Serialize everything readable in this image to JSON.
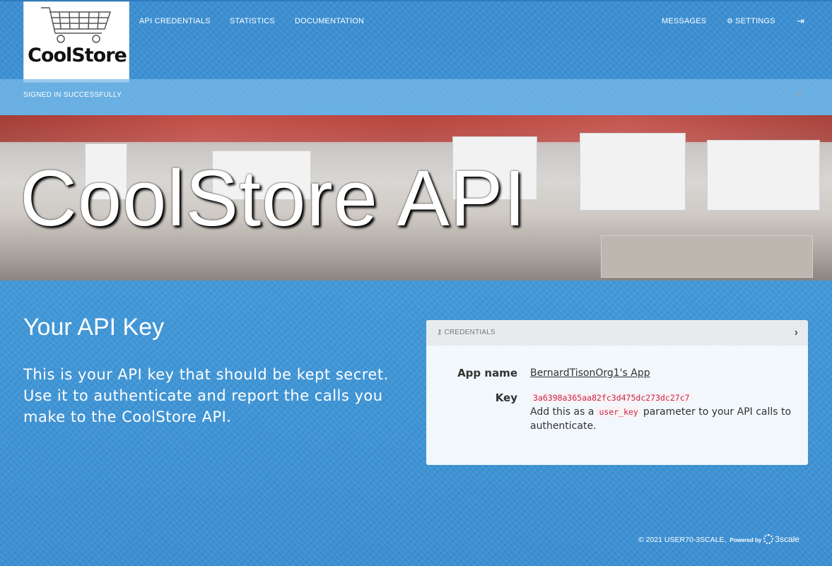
{
  "nav": {
    "logo_text": "CoolStore",
    "links": [
      {
        "label": "API CREDENTIALS"
      },
      {
        "label": "STATISTICS"
      },
      {
        "label": "DOCUMENTATION"
      }
    ],
    "messages": "MESSAGES",
    "settings": "SETTINGS",
    "settings_icon": "gears-icon",
    "logout_icon": "sign-out-icon"
  },
  "flash": {
    "message": "SIGNED IN SUCCESSFULLY",
    "close": "×"
  },
  "hero": {
    "title": "CoolStore API"
  },
  "main": {
    "heading": "Your API Key",
    "description": "This is your API key that should be kept secret. Use it to authenticate and report the calls you make to the CoolStore API."
  },
  "credentials": {
    "header": "CREDENTIALS",
    "header_icon": "key-icon",
    "app_name_label": "App name",
    "app_name": "BernardTisonOrg1's App",
    "key_label": "Key",
    "key_value": "3a6398a365aa82fc3d475dc273dc27c7",
    "hint_prefix": "Add this as a",
    "hint_param": "user_key",
    "hint_suffix": "parameter to your API calls to authenticate."
  },
  "footer": {
    "copyright": "© 2021 USER70-3SCALE,",
    "powered_by": "Powered by",
    "brand": "3scale"
  },
  "colors": {
    "background": "#3c93d6",
    "key_text": "#c7254e"
  }
}
